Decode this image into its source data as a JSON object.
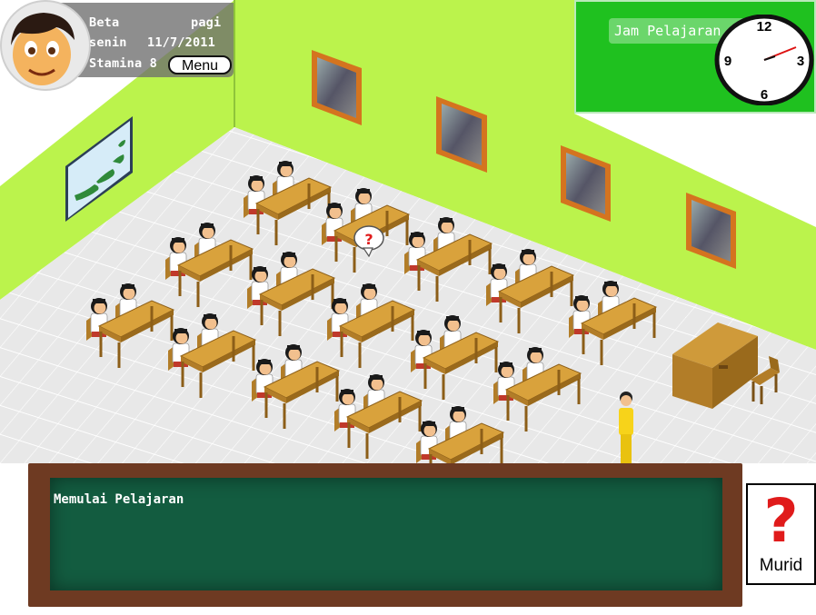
{
  "hud": {
    "player_name": "Beta",
    "time_of_day": "pagi",
    "day": "senin",
    "date": "11/7/2011",
    "stamina_label": "Stamina 8",
    "menu_label": "Menu"
  },
  "clock": {
    "label": "Jam Pelajaran",
    "numbers": [
      "12",
      "3",
      "6",
      "9"
    ]
  },
  "board": {
    "message": "Memulai Pelajaran"
  },
  "student_button": {
    "icon": "question-mark-icon",
    "symbol": "?",
    "label": "Murid"
  },
  "bubble": {
    "icon": "question-bubble-icon",
    "symbol": "?"
  },
  "colors": {
    "wall": "#bbf34c",
    "floor": "#e4e4e4",
    "desk": "#d39a31",
    "board": "#135c40",
    "board_frame": "#6e3a22",
    "clock_panel": "#1fc11f",
    "accent_red": "#e01b1b"
  }
}
